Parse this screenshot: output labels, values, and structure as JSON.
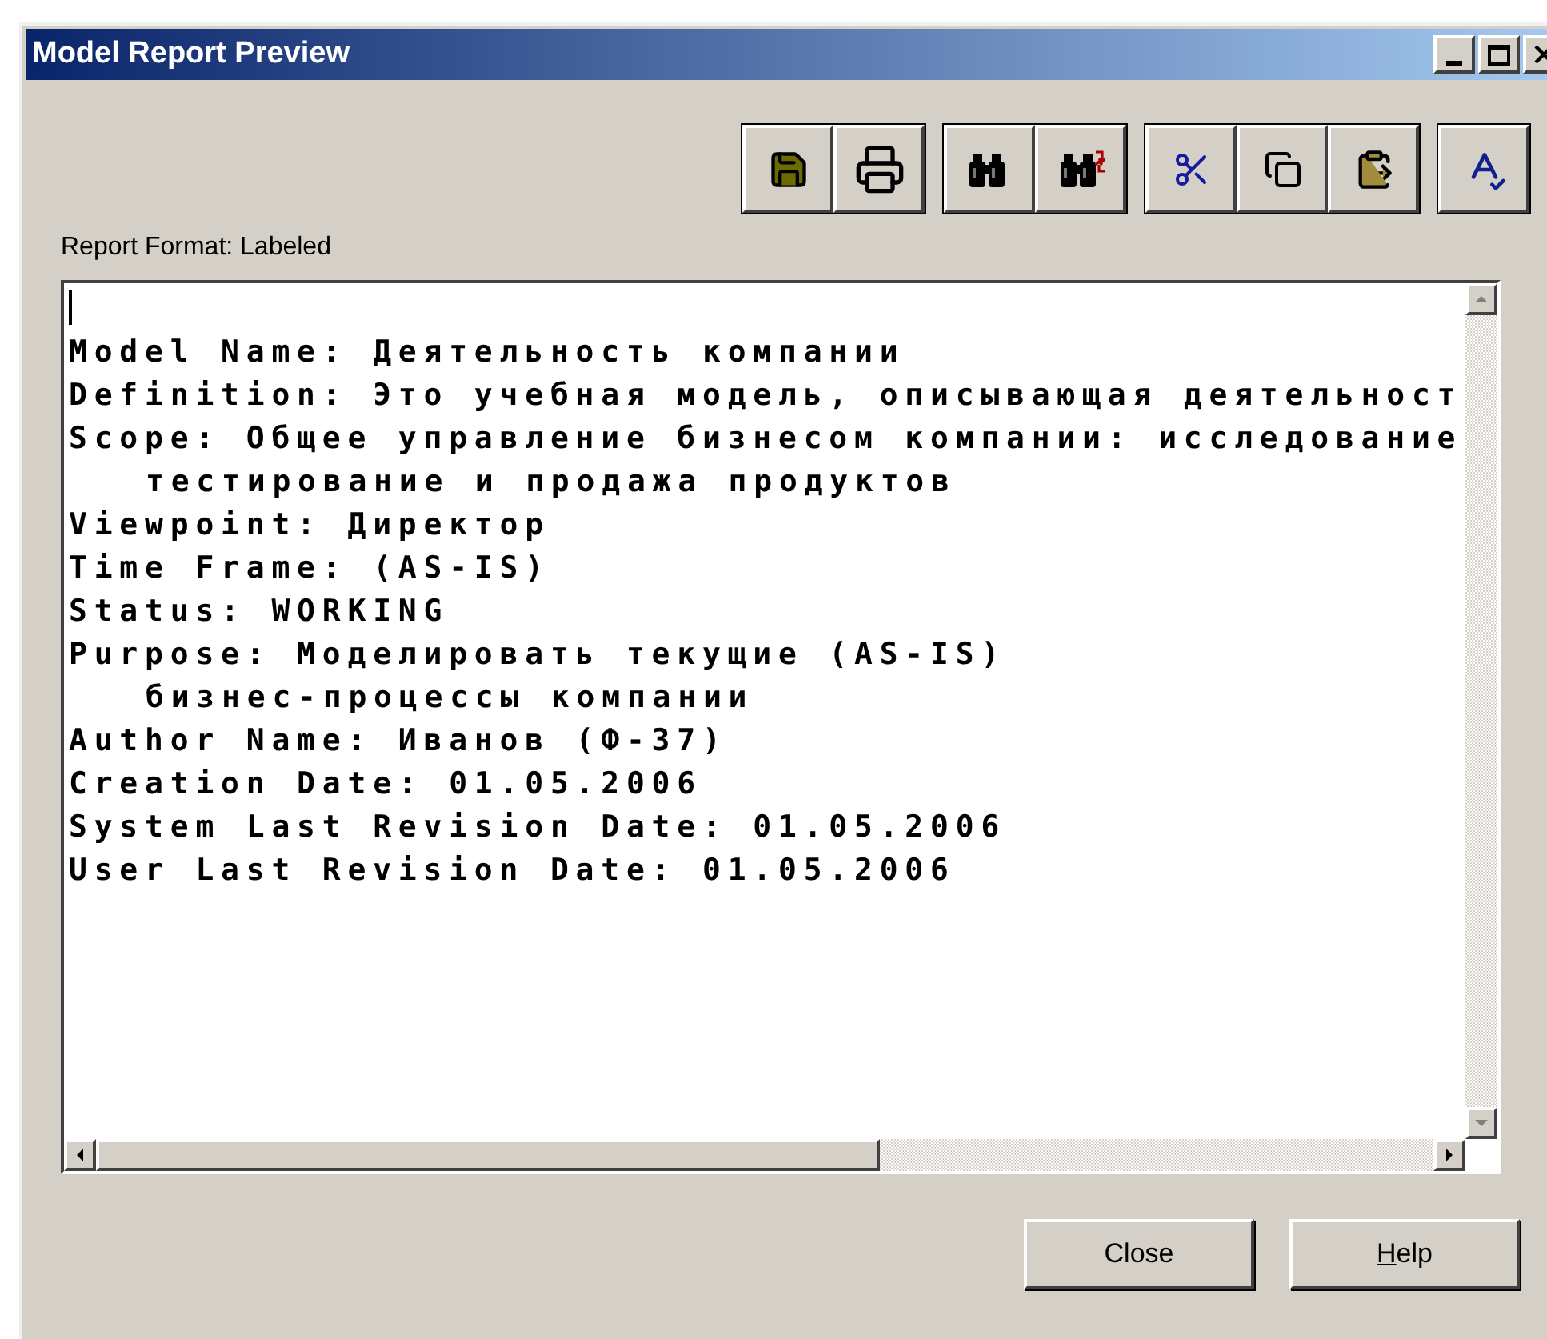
{
  "window": {
    "title": "Model Report Preview"
  },
  "toolbar": {
    "groups": [
      [
        {
          "kind": "save"
        },
        {
          "kind": "print"
        }
      ],
      [
        {
          "kind": "find"
        },
        {
          "kind": "replace"
        }
      ],
      [
        {
          "kind": "cut"
        },
        {
          "kind": "copy"
        },
        {
          "kind": "paste"
        }
      ],
      [
        {
          "kind": "spell"
        }
      ]
    ]
  },
  "report_format": "Report Format: Labeled",
  "report": {
    "lines": [
      {
        "kind": "field",
        "text": "Model Name: Деятельность компании"
      },
      {
        "kind": "field",
        "text": "Definition: Это учебная модель, описывающая деятельност"
      },
      {
        "kind": "field",
        "text": "Scope: Общее управление бизнесом компании: исследование"
      },
      {
        "kind": "continuation",
        "text": "тестирование и продажа продуктов"
      },
      {
        "kind": "field",
        "text": "Viewpoint: Директор"
      },
      {
        "kind": "field",
        "text": "Time Frame: (AS-IS)"
      },
      {
        "kind": "field",
        "text": "Status: WORKING"
      },
      {
        "kind": "field",
        "text": "Purpose: Моделировать текущие (AS-IS)"
      },
      {
        "kind": "continuation",
        "text": "бизнес-процессы компании"
      },
      {
        "kind": "field",
        "text": "Author Name: Иванов (Ф-37)"
      },
      {
        "kind": "field",
        "text": "Creation Date: 01.05.2006"
      },
      {
        "kind": "field",
        "text": "System Last Revision Date: 01.05.2006"
      },
      {
        "kind": "field",
        "text": "User Last Revision Date: 01.05.2006"
      }
    ]
  },
  "buttons": [
    {
      "label": "Close",
      "access_key_underlined": false
    },
    {
      "label": "Help",
      "access_key_underlined": true
    }
  ]
}
